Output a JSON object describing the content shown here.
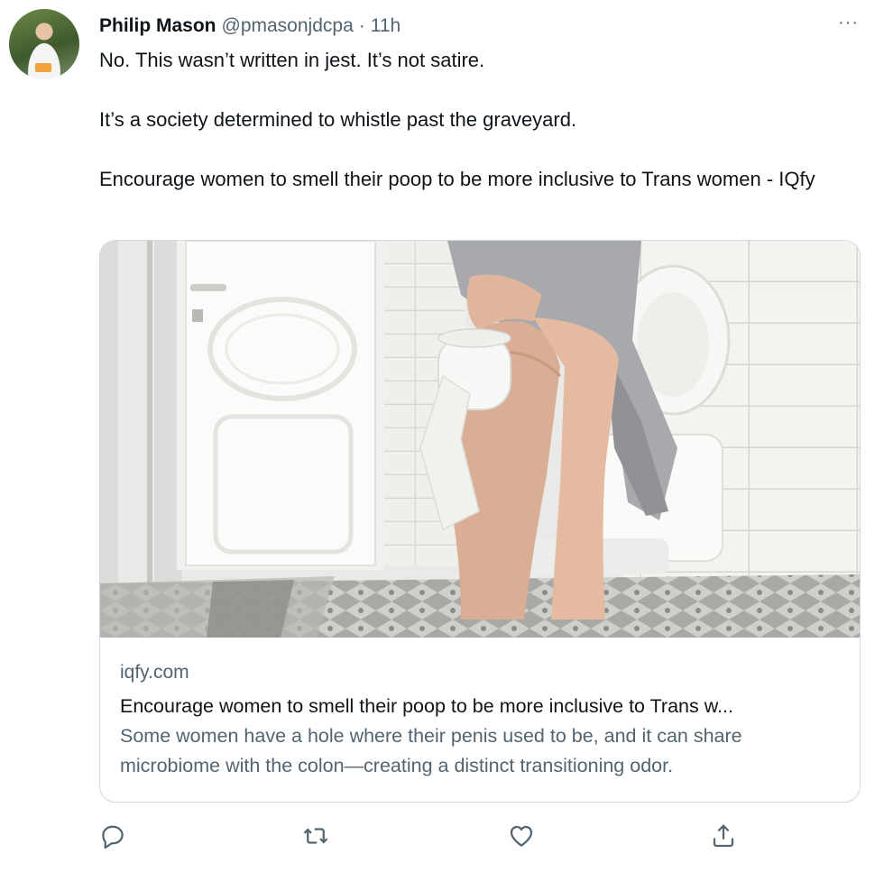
{
  "tweet": {
    "author_name": "Philip Mason",
    "author_handle": "@pmasonjdcpa",
    "separator": "·",
    "time": "11h",
    "more_label": "···",
    "text_lines": [
      "No.  This wasn’t written in jest.  It’s not satire.",
      "It’s a society determined to whistle past the graveyard.",
      "Encourage women to smell their poop to be more inclusive to Trans women - IQfy"
    ]
  },
  "card": {
    "domain": "iqfy.com",
    "title": "Encourage women to smell their poop to be more inclusive to Trans w...",
    "description": "Some women have a hole where their penis used to be, and it can share microbiome with the colon—creating a distinct transitioning odor."
  },
  "actions": [
    {
      "name": "reply",
      "icon": "reply-icon"
    },
    {
      "name": "retweet",
      "icon": "retweet-icon"
    },
    {
      "name": "like",
      "icon": "heart-icon"
    },
    {
      "name": "share",
      "icon": "share-icon"
    }
  ],
  "colors": {
    "text_primary": "#0f1419",
    "text_secondary": "#536471",
    "border": "#cfd9de"
  }
}
